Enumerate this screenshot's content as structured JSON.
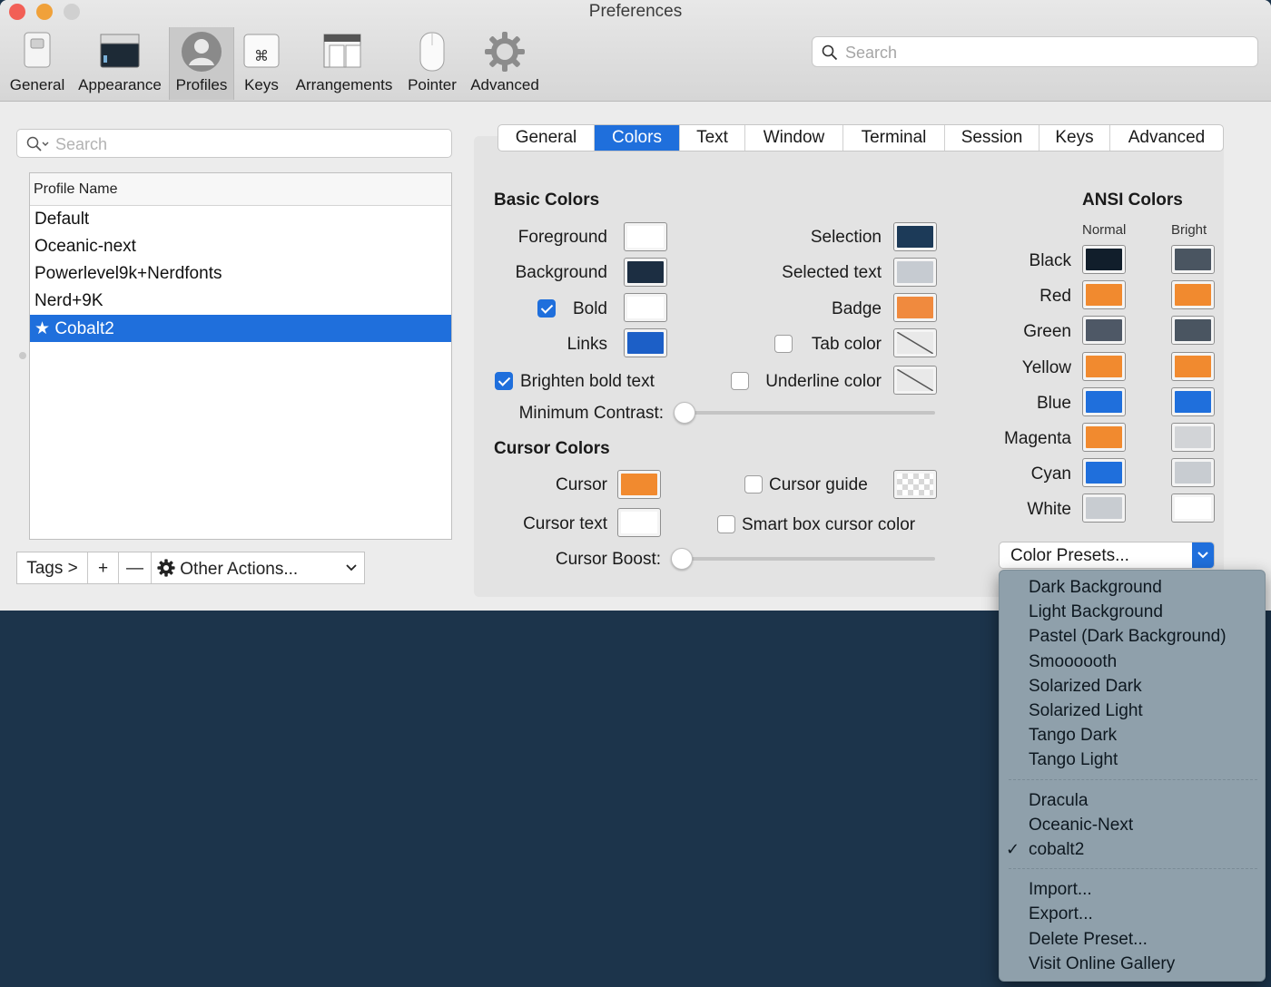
{
  "window": {
    "title": "Preferences"
  },
  "toolbar": [
    {
      "label": "General",
      "icon": "switch-icon"
    },
    {
      "label": "Appearance",
      "icon": "terminal-window-icon"
    },
    {
      "label": "Profiles",
      "icon": "user-silhouette-icon"
    },
    {
      "label": "Keys",
      "icon": "command-key-icon"
    },
    {
      "label": "Arrangements",
      "icon": "window-arrangement-icon"
    },
    {
      "label": "Pointer",
      "icon": "mouse-icon"
    },
    {
      "label": "Advanced",
      "icon": "gear-icon"
    }
  ],
  "top_search": {
    "placeholder": "Search"
  },
  "profiles": {
    "search_placeholder": "Search",
    "column_header": "Profile Name",
    "items": [
      "Default",
      "Oceanic-next",
      "Powerlevel9k+Nerdfonts",
      "Nerd+9K",
      "Cobalt2"
    ],
    "selected": "Cobalt2",
    "bottom": {
      "tags": "Tags >",
      "add": "+",
      "remove": "—",
      "other_actions": "Other Actions..."
    }
  },
  "tabs": [
    "General",
    "Colors",
    "Text",
    "Window",
    "Terminal",
    "Session",
    "Keys",
    "Advanced"
  ],
  "selected_tab": "Colors",
  "basic_colors": {
    "heading": "Basic Colors",
    "foreground": {
      "label": "Foreground",
      "color": "#ffffff"
    },
    "background": {
      "label": "Background",
      "color": "#1c2e42"
    },
    "bold": {
      "label": "Bold",
      "checked": true,
      "color": "#ffffff"
    },
    "links": {
      "label": "Links",
      "color": "#1c5fc7"
    },
    "brighten_bold": {
      "label": "Brighten bold text",
      "checked": true
    },
    "minimum_contrast": {
      "label": "Minimum Contrast:",
      "value": 0
    },
    "selection": {
      "label": "Selection",
      "color": "#1c3a58"
    },
    "selected_text": {
      "label": "Selected text",
      "color": "#c6cbd1"
    },
    "badge": {
      "label": "Badge",
      "color": "#f08a3e"
    },
    "tab_color": {
      "label": "Tab color",
      "checked": false
    },
    "underline_color": {
      "label": "Underline color",
      "checked": false
    }
  },
  "cursor_colors": {
    "heading": "Cursor Colors",
    "cursor": {
      "label": "Cursor",
      "color": "#f18a2f"
    },
    "cursor_text": {
      "label": "Cursor text",
      "color": "#ffffff"
    },
    "cursor_guide": {
      "label": "Cursor guide",
      "checked": false
    },
    "smart_box": {
      "label": "Smart box cursor color",
      "checked": false
    },
    "cursor_boost": {
      "label": "Cursor Boost:",
      "value": 0
    }
  },
  "ansi": {
    "heading": "ANSI Colors",
    "normal_label": "Normal",
    "bright_label": "Bright",
    "rows": [
      {
        "name": "Black",
        "normal": "#111e2b",
        "bright": "#4a5561"
      },
      {
        "name": "Red",
        "normal": "#f18a2f",
        "bright": "#f18a2f"
      },
      {
        "name": "Green",
        "normal": "#4e5866",
        "bright": "#4a5561"
      },
      {
        "name": "Yellow",
        "normal": "#f18a2f",
        "bright": "#f18a2f"
      },
      {
        "name": "Blue",
        "normal": "#1f6fdc",
        "bright": "#1f6fdc"
      },
      {
        "name": "Magenta",
        "normal": "#f18a2f",
        "bright": "#d2d4d7"
      },
      {
        "name": "Cyan",
        "normal": "#1f6fdc",
        "bright": "#c8ccd1"
      },
      {
        "name": "White",
        "normal": "#c8ccd1",
        "bright": "#ffffff"
      }
    ]
  },
  "color_presets": {
    "button_label": "Color Presets...",
    "group1": [
      "Dark Background",
      "Light Background",
      "Pastel (Dark Background)",
      "Smoooooth",
      "Solarized Dark",
      "Solarized Light",
      "Tango Dark",
      "Tango Light"
    ],
    "group2": [
      "Dracula",
      "Oceanic-Next",
      "cobalt2"
    ],
    "checked": "cobalt2",
    "actions": [
      "Import...",
      "Export...",
      "Delete Preset...",
      "Visit Online Gallery"
    ]
  },
  "colors": {
    "accent": "#1f6fdc",
    "desktop": "#1c344b",
    "menu": "#8fa0ab"
  }
}
